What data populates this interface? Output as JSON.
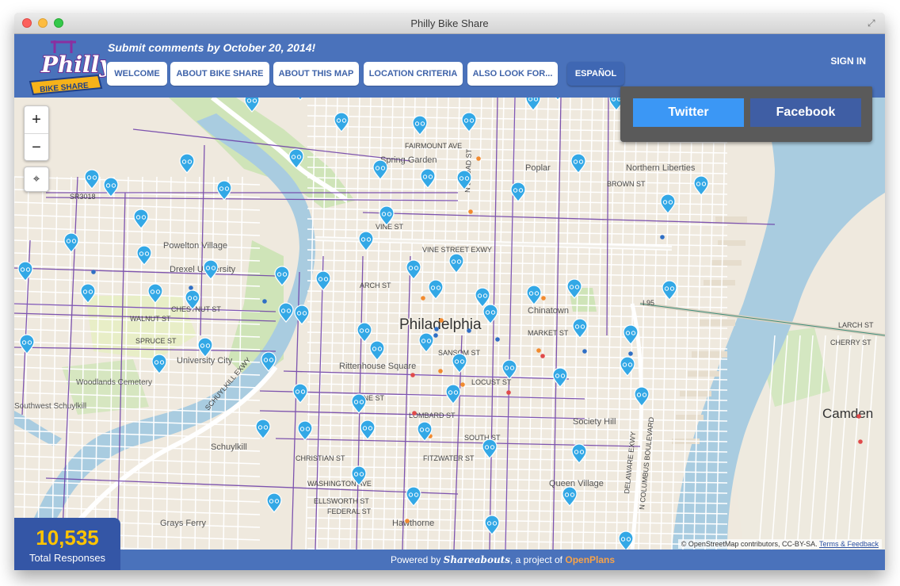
{
  "window": {
    "title": "Philly Bike Share"
  },
  "header": {
    "logo_text": "Philly",
    "logo_sub": "BIKE SHARE",
    "tagline": "Submit comments by October 20, 2014!",
    "nav": [
      {
        "label": "WELCOME"
      },
      {
        "label": "ABOUT BIKE SHARE"
      },
      {
        "label": "ABOUT THIS MAP"
      },
      {
        "label": "LOCATION CRITERIA"
      },
      {
        "label": "ALSO LOOK FOR..."
      },
      {
        "label": "ESPAÑOL"
      }
    ],
    "signin": "SIGN IN"
  },
  "share": {
    "twitter": "Twitter",
    "facebook": "Facebook"
  },
  "map": {
    "zoom_in": "+",
    "zoom_out": "−",
    "locate": "⌖",
    "attribution": "© OpenStreetMap contributors, CC-BY-SA.",
    "attribution_link": "Terms & Feedback",
    "labels": {
      "philadelphia": "Philadelphia",
      "camden": "Camden",
      "spring_garden": "Spring Garden",
      "poplar": "Poplar",
      "northern_liberties": "Northern Liberties",
      "powelton": "Powelton Village",
      "drexel": "Drexel University",
      "university_city": "University City",
      "woodlands": "Woodlands Cemetery",
      "chinatown": "Chinatown",
      "rittenhouse": "Rittenhouse Square",
      "society_hill": "Society Hill",
      "queen_village": "Queen Village",
      "hawthorne": "Hawthorne",
      "grays_ferry": "Grays Ferry",
      "schuylkill": "Schuylkill",
      "southwest": "Southwest Schuylkill",
      "fairmount_ave": "FAIRMOUNT AVE",
      "vine_st": "VINE ST",
      "vine_exwy": "VINE STREET EXWY",
      "arch_st": "ARCH ST",
      "chestnut_st": "CHESTNUT ST",
      "walnut_st": "WALNUT ST",
      "market_st": "MARKET ST",
      "spruce_st": "SPRUCE ST",
      "sansom_st": "SANSOM ST",
      "locust_st": "LOCUST ST",
      "pine_st": "PINE ST",
      "lombard_st": "LOMBARD ST",
      "south_st": "SOUTH ST",
      "fitzwater_st": "FITZWATER ST",
      "christian_st": "CHRISTIAN ST",
      "washington_ave": "WASHINGTON AVE",
      "ellsworth_st": "ELLSWORTH ST",
      "federal_st": "FEDERAL ST",
      "broad_st": "N BROAD ST",
      "brown_st": "BROWN ST",
      "schuylkill_exwy": "SCHUYLKILL EXWY",
      "i95": "I 95",
      "columbus": "N COLUMBUS BOULEVARD",
      "delaware_exwy": "DELAWARE EXWY",
      "sr3018": "SR3018",
      "larch_st": "LARCH ST",
      "cherry_st": "CHERRY ST"
    }
  },
  "stats": {
    "count": "10,535",
    "label": "Total Responses"
  },
  "footer": {
    "prefix": "Powered by ",
    "shareabouts": "Shareabouts",
    "mid": ", a project of ",
    "openplans": "OpenPlans"
  }
}
